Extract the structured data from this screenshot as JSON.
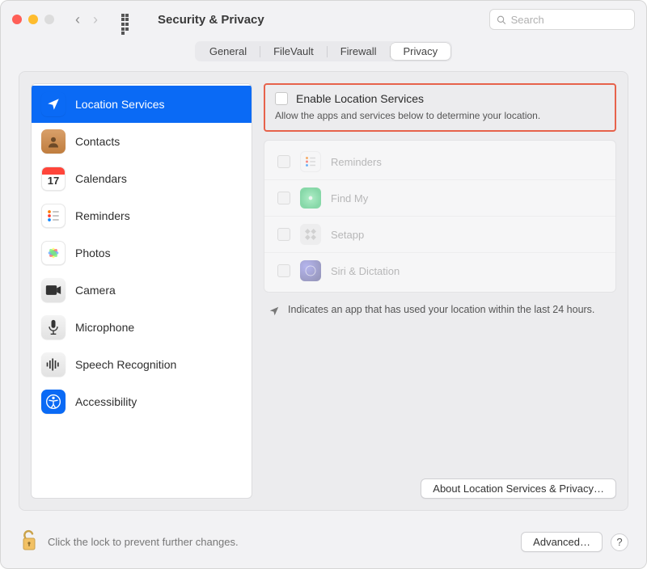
{
  "window": {
    "title": "Security & Privacy"
  },
  "search": {
    "placeholder": "Search"
  },
  "tabs": {
    "items": [
      "General",
      "FileVault",
      "Firewall",
      "Privacy"
    ],
    "active_index": 3
  },
  "sidebar": {
    "items": [
      {
        "label": "Location Services",
        "icon": "location-arrow-icon",
        "active": true
      },
      {
        "label": "Contacts",
        "icon": "contacts-icon"
      },
      {
        "label": "Calendars",
        "icon": "calendar-icon",
        "badge": "17"
      },
      {
        "label": "Reminders",
        "icon": "reminders-icon"
      },
      {
        "label": "Photos",
        "icon": "photos-icon"
      },
      {
        "label": "Camera",
        "icon": "camera-icon"
      },
      {
        "label": "Microphone",
        "icon": "microphone-icon"
      },
      {
        "label": "Speech Recognition",
        "icon": "speech-icon"
      },
      {
        "label": "Accessibility",
        "icon": "accessibility-icon"
      }
    ]
  },
  "main": {
    "enable_label": "Enable Location Services",
    "enable_subtext": "Allow the apps and services below to determine your location.",
    "apps": [
      {
        "label": "Reminders"
      },
      {
        "label": "Find My"
      },
      {
        "label": "Setapp"
      },
      {
        "label": "Siri & Dictation"
      }
    ],
    "indicator_note": "Indicates an app that has used your location within the last 24 hours.",
    "about_button": "About Location Services & Privacy…"
  },
  "footer": {
    "lock_text": "Click the lock to prevent further changes.",
    "advanced_button": "Advanced…",
    "help": "?"
  }
}
